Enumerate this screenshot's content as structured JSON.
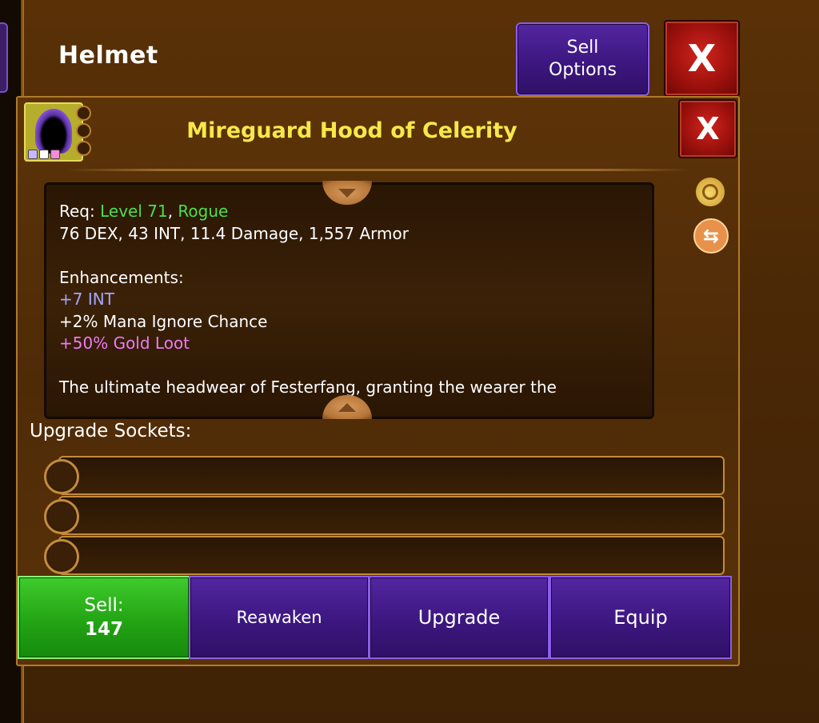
{
  "screen": {
    "title": "Helmet",
    "sell_options_label_line1": "Sell",
    "sell_options_label_line2": "Options",
    "close_label": "X"
  },
  "item": {
    "name": "Mireguard Hood of Celerity",
    "close_label": "X",
    "requirement_prefix": "Req: ",
    "requirement_level": "Level 71",
    "requirement_separator": ", ",
    "requirement_class": "Rogue",
    "stats": "76 DEX, 43 INT, 11.4 Damage, 1,557 Armor",
    "enhancements_heading": "Enhancements:",
    "enhancements": [
      {
        "text": "+7 INT",
        "color": "#a2a6ff"
      },
      {
        "text": "+2% Mana Ignore Chance",
        "color": "#ffffff"
      },
      {
        "text": "+50% Gold Loot",
        "color": "#ec7bf0"
      }
    ],
    "description": "The ultimate headwear of Festerfang, granting the wearer the",
    "gem_colors": [
      "#c9b7ff",
      "#ffffff",
      "#f48ad8"
    ]
  },
  "sockets": {
    "label": "Upgrade Sockets:",
    "slots": 3
  },
  "actions": {
    "sell_label": "Sell:",
    "sell_value": "147",
    "reawaken_label": "Reawaken",
    "upgrade_label": "Upgrade",
    "equip_label": "Equip"
  },
  "icons": {
    "bag": "gold-bag-icon",
    "swap": "swap-arrows-icon",
    "scroll_down": "chevron-down-icon",
    "scroll_up": "chevron-up-icon"
  }
}
